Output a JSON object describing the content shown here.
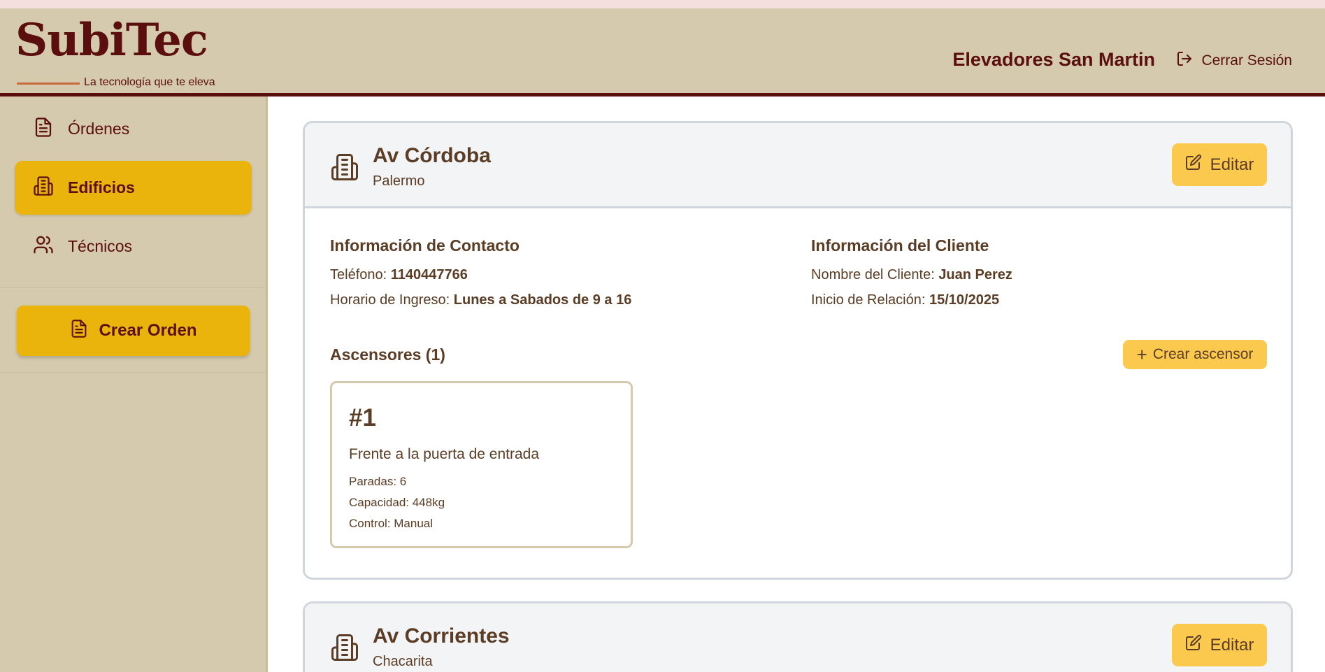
{
  "brand": {
    "name": "SubiTec",
    "tagline": "La tecnología que te eleva"
  },
  "header": {
    "company": "Elevadores San Martin",
    "logout_label": "Cerrar Sesión"
  },
  "sidebar": {
    "items": [
      {
        "label": "Órdenes",
        "icon": "document-icon",
        "active": false
      },
      {
        "label": "Edificios",
        "icon": "building-icon",
        "active": true
      },
      {
        "label": "Técnicos",
        "icon": "users-icon",
        "active": false
      }
    ],
    "create_order_label": "Crear Orden"
  },
  "buildings": [
    {
      "name": "Av Córdoba",
      "neighborhood": "Palermo",
      "edit_label": "Editar",
      "contact_heading": "Información de Contacto",
      "phone_label": "Teléfono:",
      "phone": "1140447766",
      "hours_label": "Horario de Ingreso:",
      "hours": "Lunes a Sabados de 9 a 16",
      "client_heading": "Información del Cliente",
      "client_name_label": "Nombre del Cliente:",
      "client_name": "Juan Perez",
      "relation_label": "Inicio de Relación:",
      "relation_start": "15/10/2025",
      "elevators_heading": "Ascensores (1)",
      "add_elevator_label": "Crear ascensor",
      "elevators": [
        {
          "number": "#1",
          "location": "Frente a la puerta de entrada",
          "stops": "Paradas: 6",
          "capacity": "Capacidad: 448kg",
          "control": "Control: Manual"
        }
      ]
    },
    {
      "name": "Av Corrientes",
      "neighborhood": "Chacarita",
      "edit_label": "Editar"
    }
  ],
  "colors": {
    "maroon": "#5a0e0e",
    "sand": "#d5caae",
    "gold": "#ebb40c",
    "light_gold": "#fcc94f",
    "brown_text": "#5b3d26"
  }
}
